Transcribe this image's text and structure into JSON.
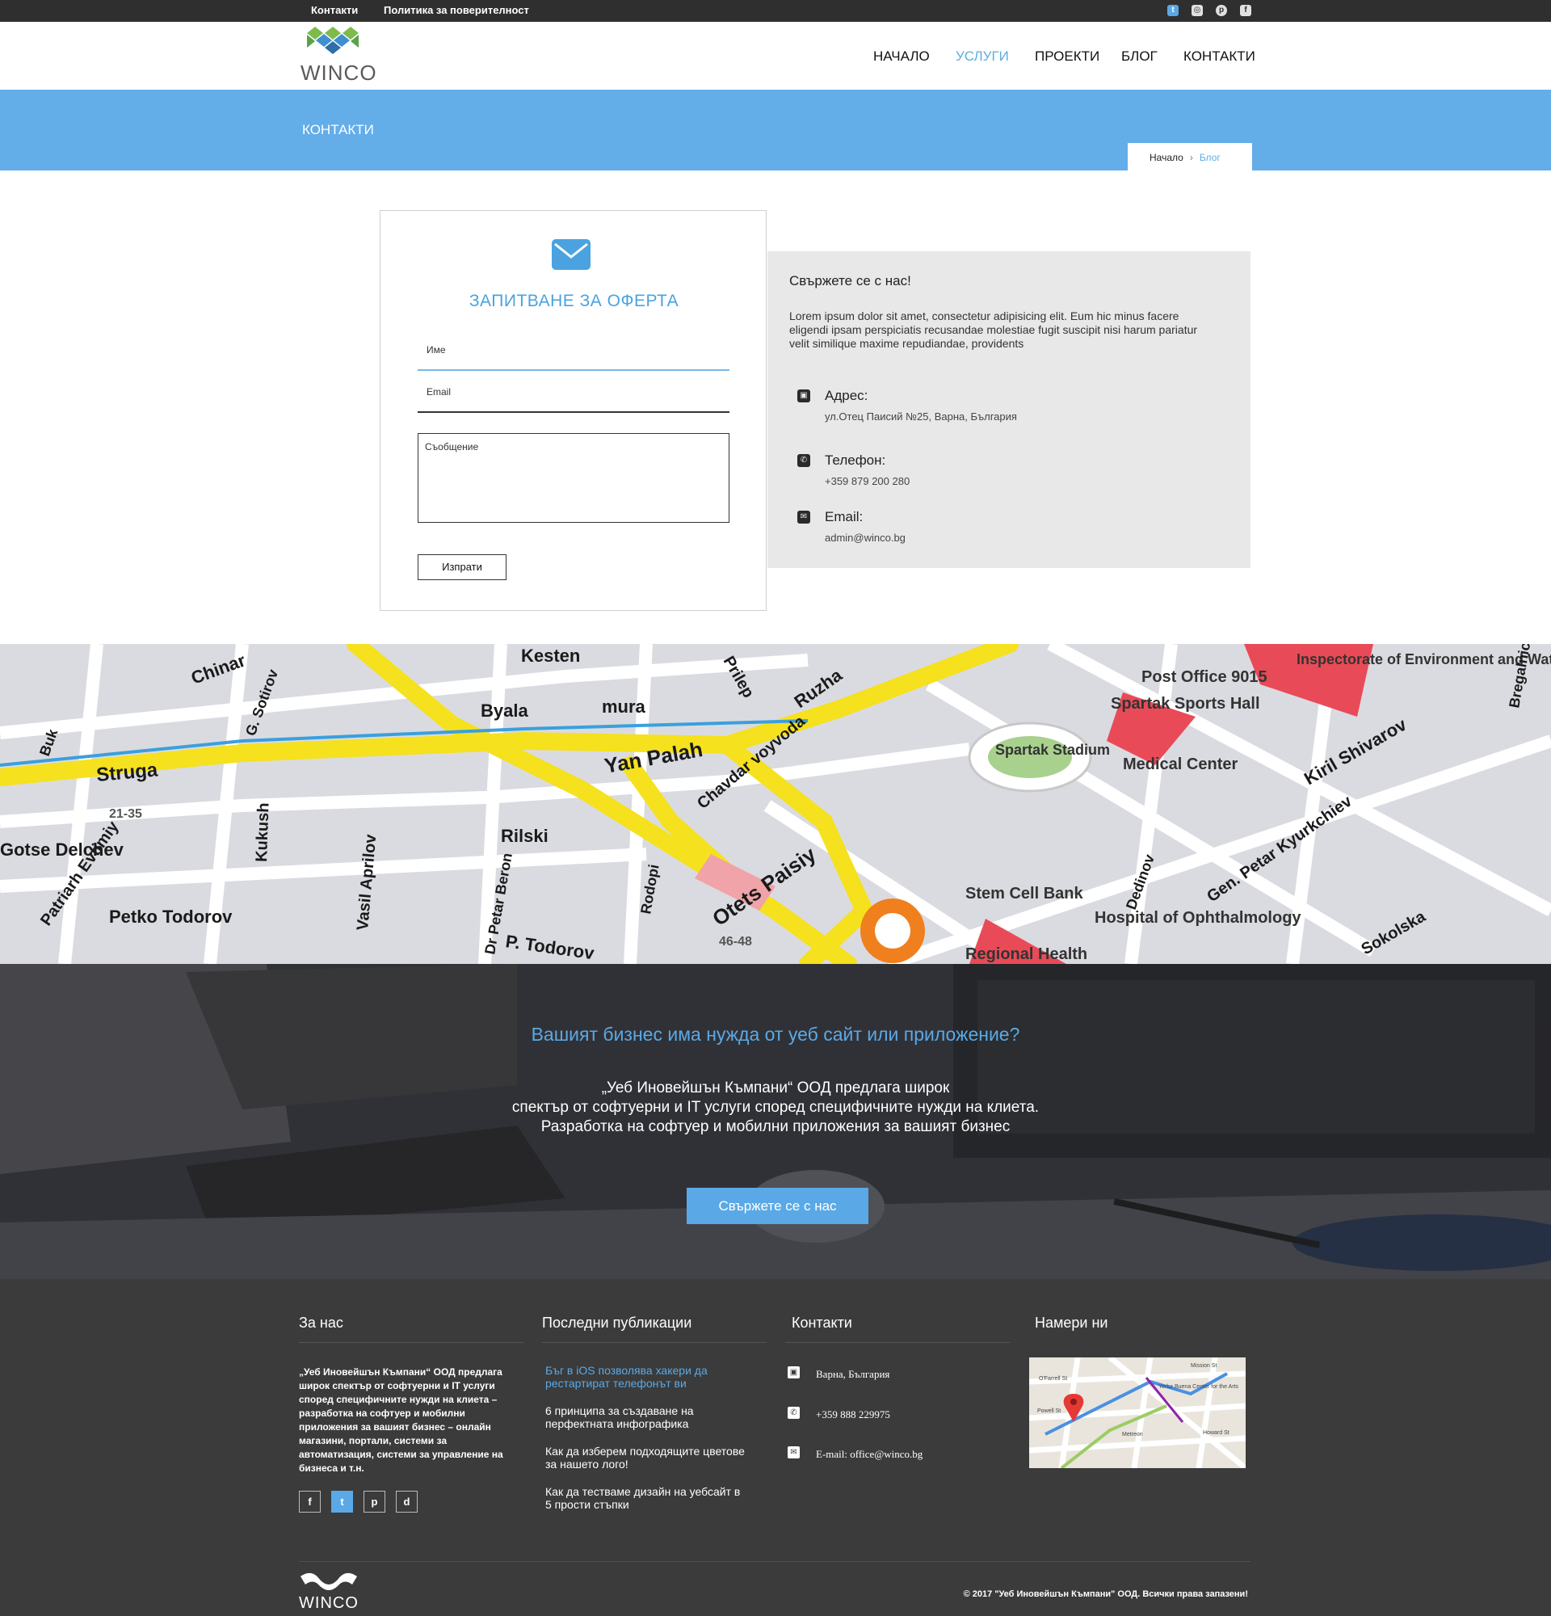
{
  "topbar": {
    "links": [
      "Контакти",
      "Политика за поверителност"
    ],
    "social_icons": [
      "twitter-icon",
      "dribbble-icon",
      "pinterest-icon",
      "facebook-icon"
    ]
  },
  "header": {
    "logo_text": "WINCO",
    "nav": [
      "НАЧАЛО",
      "УСЛУГИ",
      "ПРОЕКТИ",
      "БЛОГ",
      "КОНТАКТИ"
    ],
    "active_nav": "УСЛУГИ"
  },
  "banner": {
    "title": "КОНТАКТИ",
    "breadcrumb": [
      "Начало",
      "Блог"
    ]
  },
  "form": {
    "title": "ЗАПИТВАНЕ ЗА ОФЕРТА",
    "name_label": "Име",
    "email_label": "Email",
    "message_label": "Съобщение",
    "submit_label": "Изпрати"
  },
  "info": {
    "title": "Свържете се с нас!",
    "text": "Lorem ipsum dolor sit amet, consectetur adipisicing elit. Eum hic minus facere  eligendi ipsam perspiciatis recusandae molestiae fugit suscipit nisi harum pariatur velit similique maxime repudiandae, providents",
    "rows": [
      {
        "label": "Адрес:",
        "value": "ул.Отец Паисий №25, Варна, България",
        "icon": "contact-card-icon"
      },
      {
        "label": "Телефон:",
        "value": "+359 879 200 280",
        "icon": "phone-icon"
      },
      {
        "label": "Email:",
        "value": "admin@winco.bg",
        "icon": "envelope-open-icon"
      }
    ]
  },
  "map": {
    "labels": [
      "Kesten",
      "Chinar",
      "Struga",
      "Yan Palah",
      "Byala",
      "mura",
      "Ruzha",
      "Prilep",
      "Gotse Delchev",
      "Petko Todorov",
      "Kukush",
      "Vasil Aprilov",
      "Rilski",
      "P. Todorov",
      "Otets Paisiy",
      "Chavdar voyvoda",
      "Spartak Stadium",
      "Spartak Sports Hall",
      "Post Office 9015",
      "Inspectorate of Environment and Waters",
      "Medical Center",
      "Kiril Shivarov",
      "Stem Cell Bank",
      "Hospital of Ophthalmology",
      "Regional Health",
      "Sokolska",
      "Patriarh Evtimiy",
      "Gen. Petar Kyurkchiev",
      "21-35",
      "46-48",
      "Rodopi",
      "Dr Petar Beron",
      "Dedinov",
      "Bregalnica",
      "Buk",
      "G. Sotirov"
    ]
  },
  "cta": {
    "title": "Вашият бизнес има нужда от уеб сайт или приложение?",
    "lines": [
      "„Уеб Иновейшън Къмпани“ ООД предлага широк",
      "спектър от софтуерни и IT услуги според специфичните нужди на клиета.",
      "Разработка на софтуер и мобилни приложения за вашият бизнес"
    ],
    "button": "Свържете се с нас"
  },
  "footer": {
    "about_title": "За нас",
    "about_text": "„Уеб Иновейшън Къмпани“ ООД предлага широк спектър от софтуерни и IT услуги според специфичните нужди на клиета – разработка на софтуер и мобилни приложения за вашият бизнес – онлайн магазини, портали, системи за автоматизация, системи за управление на бизнеса и т.н.",
    "social": [
      "f",
      "t",
      "p",
      "d"
    ],
    "posts_title": "Последни публикации",
    "posts": [
      "Бъг в iOS позволява хакери да рестартират телефонът ви",
      "6 принципа за създаване на перфектната инфографика",
      "Как да изберем подходящите цветове за нашето лого!",
      "Как да тестваме дизайн на уебсайт в 5 прости стъпки"
    ],
    "contacts_title": "Контакти",
    "contacts": [
      "Варна, България",
      "+359 888 229975",
      "E-mail: office@winco.bg"
    ],
    "find_title": "Намери ни",
    "map_labels": [
      "O'Farrell St",
      "Powell St",
      "Metreon",
      "Yerba Buena Center for the Arts",
      "Mission St",
      "Howard St"
    ],
    "logo_text": "WINCO",
    "copyright": "© 2017 \"Уеб Иновейшън Къмпани\" ООД. Всички права запазени!"
  },
  "colors": {
    "accent": "#5aa9e6",
    "banner": "#63ade8",
    "dark": "#2f2f2f",
    "footer": "#3b3b3b"
  }
}
